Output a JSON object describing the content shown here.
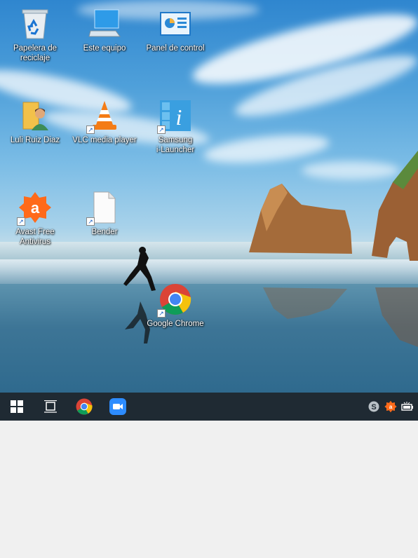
{
  "desktop": {
    "icons": [
      {
        "label": "Papelera de\nreciclaje",
        "icon": "recycle-bin-icon"
      },
      {
        "label": "Este equipo",
        "icon": "computer-icon"
      },
      {
        "label": "Panel de control",
        "icon": "control-panel-icon"
      },
      {
        "label": "Luli Ruiz Diaz",
        "icon": "user-folder-icon"
      },
      {
        "label": "VLC media player",
        "icon": "vlc-icon"
      },
      {
        "label": "Samsung\ni-Launcher",
        "icon": "samsung-launcher-icon"
      },
      {
        "label": "Avast Free\nAntivirus",
        "icon": "avast-icon"
      },
      {
        "label": "Bender",
        "icon": "file-icon"
      },
      {
        "label": "Google Chrome",
        "icon": "chrome-icon"
      }
    ]
  },
  "taskbar": {
    "start": "windows-logo-icon",
    "task_view": "task-view-icon",
    "pinned": [
      "chrome-icon",
      "zoom-icon"
    ],
    "tray": [
      "skype-icon",
      "avast-tray-icon",
      "battery-icon"
    ]
  },
  "colors": {
    "taskbar": "#1f2a33",
    "avast": "#ff6a1a",
    "zoom": "#2d8cff"
  }
}
